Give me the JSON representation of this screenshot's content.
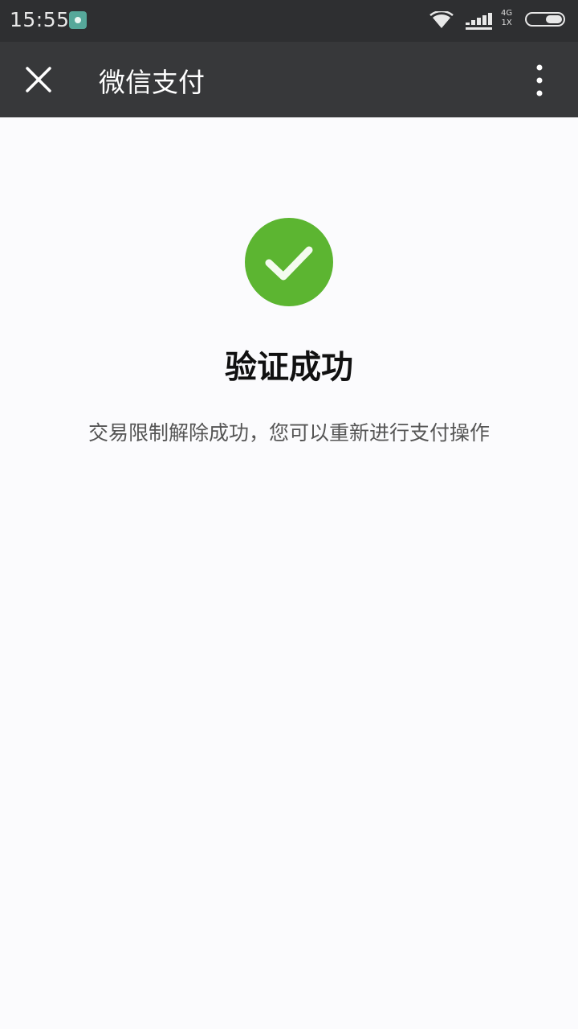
{
  "status_bar": {
    "time": "15:55",
    "network_top": "4G",
    "network_bottom": "1X",
    "icons": [
      "app-notification-icon",
      "wifi-icon",
      "signal-icon",
      "battery-icon"
    ]
  },
  "navbar": {
    "title": "微信支付",
    "close_icon": "close-icon",
    "more_icon": "more-vertical-icon",
    "background": "#37383a"
  },
  "result": {
    "icon": "success-check-icon",
    "icon_color": "#5cb531",
    "heading": "验证成功",
    "description": "交易限制解除成功，您可以重新进行支付操作"
  }
}
